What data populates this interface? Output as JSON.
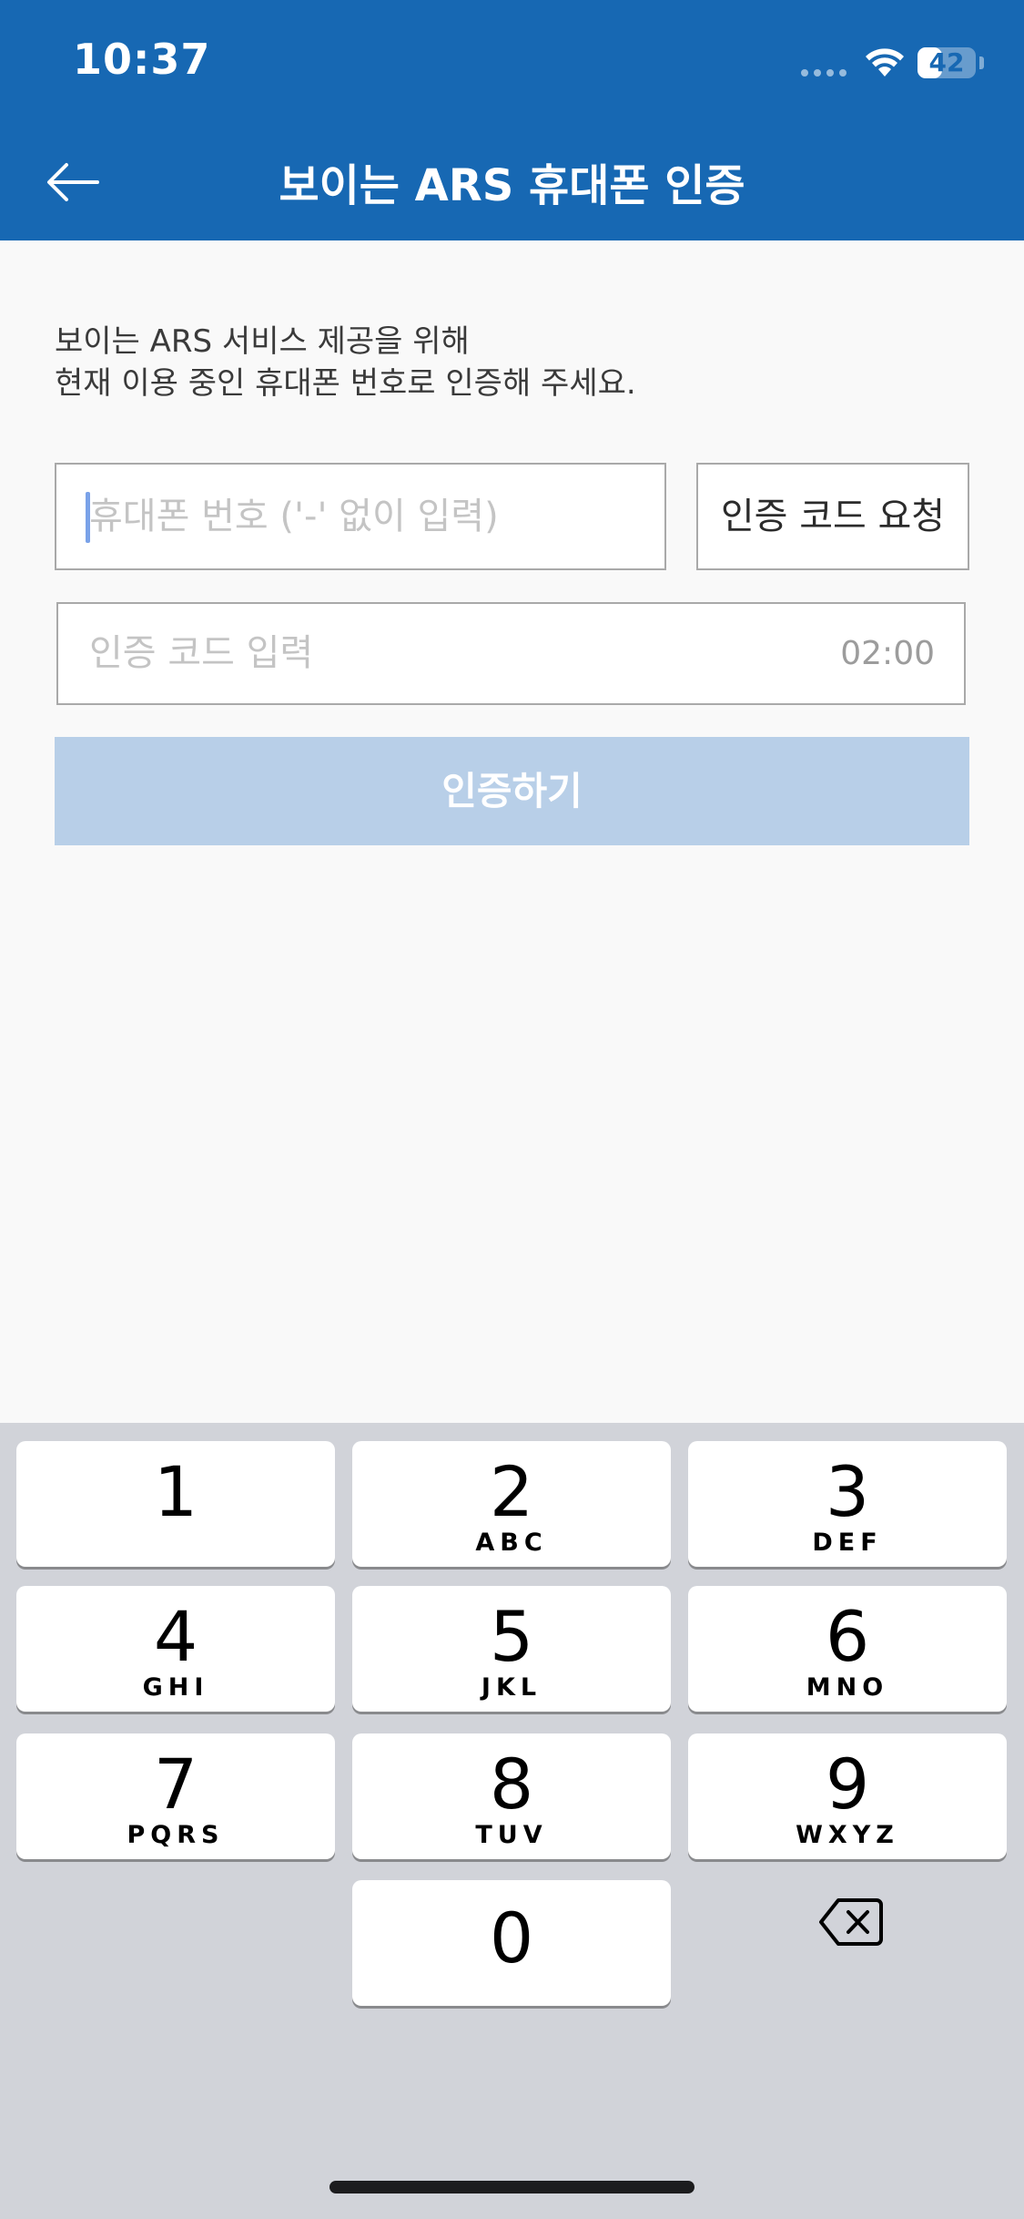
{
  "status_bar": {
    "time": "10:37",
    "battery": "42",
    "battery_level": 0.42
  },
  "header": {
    "title": "보이는 ARS 휴대폰 인증",
    "background": "#1768b3",
    "back_icon": "arrow-left-icon"
  },
  "description": {
    "line1": "보이는 ARS 서비스 제공을 위해",
    "line2": "현재 이용 중인 휴대폰 번호로 인증해 주세요."
  },
  "phone_input": {
    "value": "",
    "placeholder": "휴대폰 번호 ('-' 없이 입력)"
  },
  "request_button": {
    "label": "인증 코드 요청"
  },
  "code_input": {
    "value": "",
    "placeholder": "인증 코드 입력",
    "timer": "02:00"
  },
  "verify_button": {
    "label": "인증하기",
    "color": "#b8cfe8"
  },
  "keyboard": {
    "keys": [
      {
        "digit": "1",
        "letters": ""
      },
      {
        "digit": "2",
        "letters": "ABC"
      },
      {
        "digit": "3",
        "letters": "DEF"
      },
      {
        "digit": "4",
        "letters": "GHI"
      },
      {
        "digit": "5",
        "letters": "JKL"
      },
      {
        "digit": "6",
        "letters": "MNO"
      },
      {
        "digit": "7",
        "letters": "PQRS"
      },
      {
        "digit": "8",
        "letters": "TUV"
      },
      {
        "digit": "9",
        "letters": "WXYZ"
      },
      {
        "digit": "0",
        "letters": ""
      }
    ],
    "delete_icon": "backspace-icon"
  }
}
